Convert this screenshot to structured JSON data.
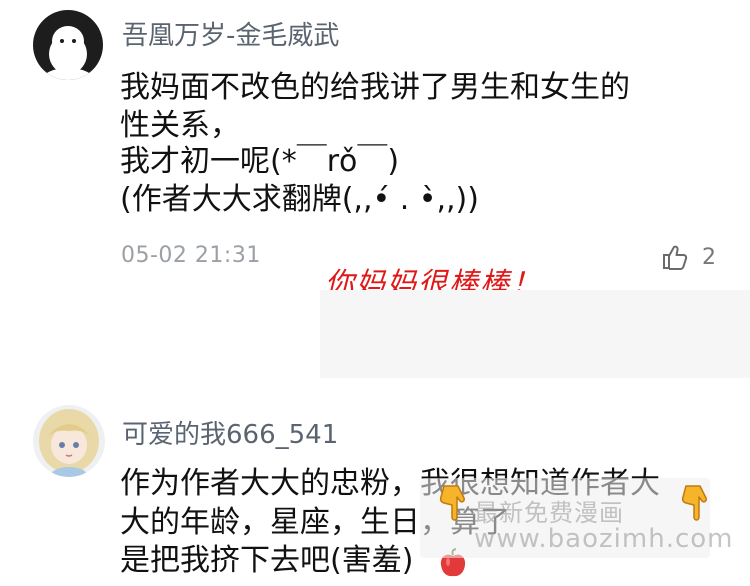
{
  "comments": [
    {
      "username": "吾凰万岁-金毛威武",
      "lines": [
        "我妈面不改色的给我讲了男生和女生的",
        "性关系，",
        "我才初一呢(*￣rǒ￣)",
        "(作者大大求翻牌(,,•́ . •̀,,))"
      ],
      "timestamp": "05-02 21:31",
      "like_count": "2"
    },
    {
      "username": "可爱的我666_541",
      "lines": [
        "作为作者大大的忠粉，我很想知道作者大",
        "大的年龄，星座，生日，算了",
        "是把我挤下去吧(害羞)"
      ]
    }
  ],
  "annotation": "你妈妈很棒棒！",
  "watermark": {
    "line1": "最新免费漫画",
    "line2": "www.baozimh.com"
  },
  "icons": {
    "like": "thumbs-up-icon",
    "pointer": "hand-pointer-icon",
    "apple": "apple-emoji-icon"
  },
  "colors": {
    "annotation": "#e01818",
    "username": "#5a6470",
    "meta": "#9aa0a6",
    "avatar_dark": "#1d1d1d"
  }
}
